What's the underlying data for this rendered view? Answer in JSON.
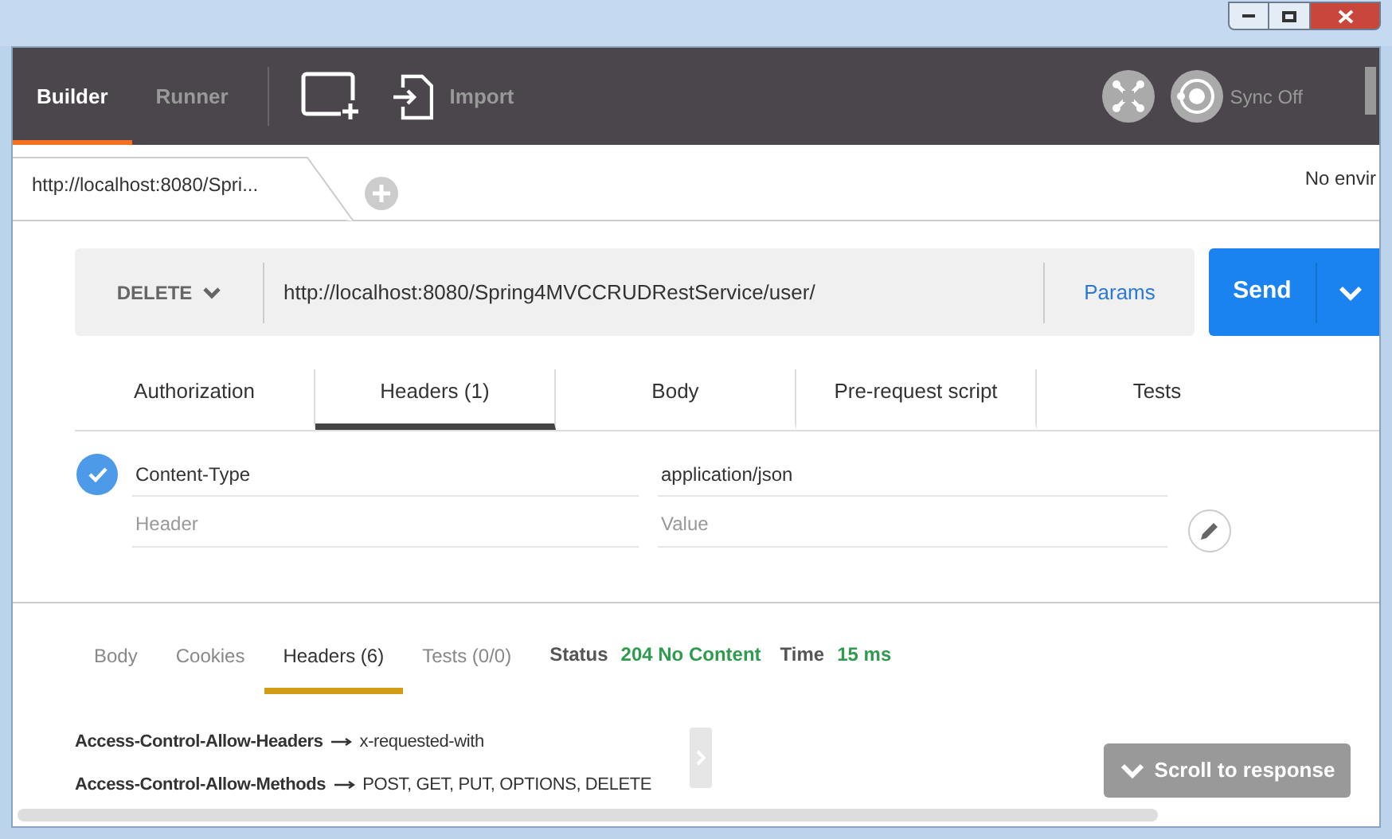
{
  "header": {
    "tabs": [
      {
        "label": "Builder",
        "selected": true
      },
      {
        "label": "Runner",
        "selected": false
      }
    ],
    "import_label": "Import",
    "sync_label": "Sync Off"
  },
  "request_tabs": [
    {
      "label": "http://localhost:8080/Spri...",
      "selected": true
    }
  ],
  "environment": "No envir",
  "request": {
    "method": "DELETE",
    "url": "http://localhost:8080/Spring4MVCCRUDRestService/user/",
    "params": "Params",
    "send": "Send"
  },
  "editor_tabs": [
    {
      "label": "Authorization",
      "selected": false
    },
    {
      "label": "Headers (1)",
      "selected": true
    },
    {
      "label": "Body",
      "selected": false
    },
    {
      "label": "Pre-request script",
      "selected": false
    },
    {
      "label": "Tests",
      "selected": false
    }
  ],
  "headers": [
    {
      "checked": true,
      "key": "Content-Type",
      "value": "application/json"
    }
  ],
  "new_header": {
    "key_placeholder": "Header",
    "value_placeholder": "Value"
  },
  "response_tabs": [
    {
      "label": "Body",
      "selected": false
    },
    {
      "label": "Cookies",
      "selected": false
    },
    {
      "label": "Headers (6)",
      "selected": true
    },
    {
      "label": "Tests (0/0)",
      "selected": false
    }
  ],
  "status": {
    "label": "Status",
    "value": "204 No Content",
    "time_label": "Time",
    "time_value": "15 ms"
  },
  "response_headers": [
    {
      "name": "Access-Control-Allow-Headers",
      "value": "x-requested-with"
    },
    {
      "name": "Access-Control-Allow-Methods",
      "value": "POST, GET, PUT, OPTIONS, DELETE"
    }
  ],
  "scroll_button": "Scroll to response"
}
